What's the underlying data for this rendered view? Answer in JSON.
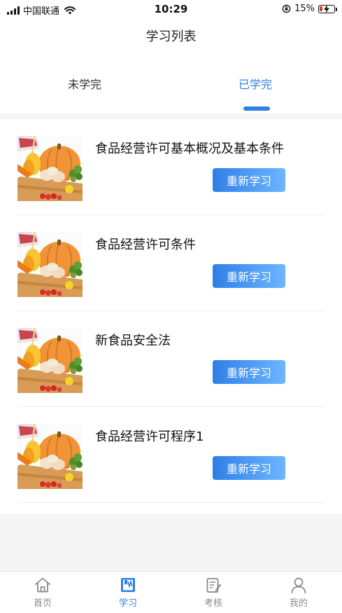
{
  "status_bar": {
    "carrier": "中国联通",
    "time": "10:29",
    "battery": "15%"
  },
  "nav": {
    "title": "学习列表"
  },
  "tabs": [
    {
      "label": "未学完",
      "active": false
    },
    {
      "label": "已学完",
      "active": true
    }
  ],
  "accent_color": "#2f7fe6",
  "courses": [
    {
      "title": "食品经营许可基本概况及基本条件",
      "button": "重新学习"
    },
    {
      "title": "食品经营许可条件",
      "button": "重新学习"
    },
    {
      "title": "新食品安全法",
      "button": "重新学习"
    },
    {
      "title": "食品经营许可程序1",
      "button": "重新学习"
    }
  ],
  "tabbar": [
    {
      "label": "首页",
      "icon": "home-icon",
      "active": false
    },
    {
      "label": "学习",
      "icon": "book-icon",
      "active": true
    },
    {
      "label": "考核",
      "icon": "clipboard-edit-icon",
      "active": false
    },
    {
      "label": "我的",
      "icon": "person-icon",
      "active": false
    }
  ]
}
